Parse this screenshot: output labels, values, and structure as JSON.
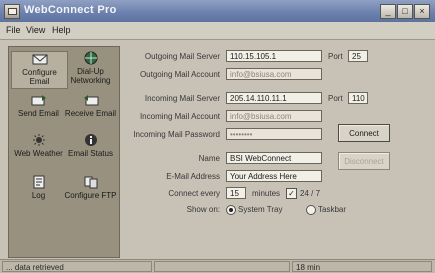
{
  "window": {
    "title": "WebConnect Pro",
    "controls": {
      "minimize": "_",
      "maximize": "□",
      "close": "×"
    }
  },
  "menu": [
    "File",
    "View",
    "Help"
  ],
  "sidebar": {
    "items": [
      {
        "label": "Configure Email",
        "icon": "envelope-icon",
        "selected": true
      },
      {
        "label": "Dial-Up Networking",
        "icon": "globe-icon",
        "selected": false
      },
      {
        "label": "Send Email",
        "icon": "send-email-icon",
        "selected": false
      },
      {
        "label": "Receive Email",
        "icon": "receive-email-icon",
        "selected": false
      },
      {
        "label": "Web Weather",
        "icon": "weather-icon",
        "selected": false
      },
      {
        "label": "Email Status",
        "icon": "info-icon",
        "selected": false
      },
      {
        "label": "Log",
        "icon": "log-icon",
        "selected": false
      },
      {
        "label": "Configure FTP",
        "icon": "ftp-icon",
        "selected": false
      }
    ]
  },
  "form": {
    "outgoing_server": {
      "label": "Outgoing Mail Server",
      "value": "110.15.105.1",
      "port_label": "Port",
      "port": "25"
    },
    "outgoing_account": {
      "label": "Outgoing Mail Account",
      "value": "info@bsiusa.com"
    },
    "incoming_server": {
      "label": "Incoming Mail Server",
      "value": "205.14.110.11.1",
      "port_label": "Port",
      "port": "110"
    },
    "incoming_account": {
      "label": "Incoming Mail Account",
      "value": "info@bsiusa.com"
    },
    "incoming_password": {
      "label": "Incoming Mail Password",
      "value": "••••••••"
    },
    "connect_label": "Connect",
    "name": {
      "label": "Name",
      "value": "BSI WebConnect"
    },
    "disconnect_label": "Disconnect",
    "email": {
      "label": "E-Mail Address",
      "value": "Your Address Here"
    },
    "connect_every": {
      "label": "Connect every",
      "value": "15",
      "unit": "minutes",
      "check": "✓",
      "always_label": "24 / 7"
    },
    "show_on": {
      "label": "Show on:",
      "option_tray": "System Tray",
      "option_taskbar": "Taskbar"
    }
  },
  "status": {
    "message": "... data retrieved",
    "middle": "",
    "right": "18 min"
  },
  "colors": {
    "titlebar": "#6b80ad",
    "sidebar": "#99917f",
    "window": "#c8c2b6"
  }
}
